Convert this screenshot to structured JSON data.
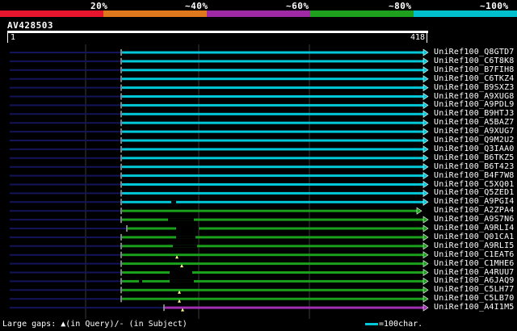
{
  "legend": {
    "labels": [
      "20%",
      "~40%",
      "~60%",
      "~80%",
      "~100%"
    ],
    "colors": [
      "#e8162c",
      "#e0781e",
      "#a02aa4",
      "#1ea01e",
      "#00c0d0"
    ]
  },
  "query": {
    "id": "AV428503",
    "start_label": "1",
    "end_label": "418"
  },
  "colors": {
    "cyan": "#00c8d8",
    "green": "#1aa01a",
    "purple": "#a030b0",
    "navy": "#14145a",
    "grid": "#3a3a3a",
    "gap_marker": "#ffff90"
  },
  "hits": [
    {
      "name": "UniRef100_Q8GTD7",
      "identity": "cyan"
    },
    {
      "name": "UniRef100_C6T8K8",
      "identity": "cyan"
    },
    {
      "name": "UniRef100_B7FIH8",
      "identity": "cyan"
    },
    {
      "name": "UniRef100_C6TKZ4",
      "identity": "cyan"
    },
    {
      "name": "UniRef100_B9SXZ3",
      "identity": "cyan"
    },
    {
      "name": "UniRef100_A9XUG8",
      "identity": "cyan"
    },
    {
      "name": "UniRef100_A9PDL9",
      "identity": "cyan"
    },
    {
      "name": "UniRef100_B9HTJ3",
      "identity": "cyan"
    },
    {
      "name": "UniRef100_A5BAZ7",
      "identity": "cyan"
    },
    {
      "name": "UniRef100_A9XUG7",
      "identity": "cyan"
    },
    {
      "name": "UniRef100_Q9M2U2",
      "identity": "cyan"
    },
    {
      "name": "UniRef100_Q3IAA0",
      "identity": "cyan"
    },
    {
      "name": "UniRef100_B6TKZ5",
      "identity": "cyan"
    },
    {
      "name": "UniRef100_B6T423",
      "identity": "cyan"
    },
    {
      "name": "UniRef100_B4F7W8",
      "identity": "cyan"
    },
    {
      "name": "UniRef100_C5XQ01",
      "identity": "cyan"
    },
    {
      "name": "UniRef100_Q5ZED1",
      "identity": "cyan"
    },
    {
      "name": "UniRef100_A9PGI4",
      "identity": "cyan"
    },
    {
      "name": "UniRef100_A2ZPA4",
      "identity": "green"
    },
    {
      "name": "UniRef100_A9S7N6",
      "identity": "green"
    },
    {
      "name": "UniRef100_A9RLI4",
      "identity": "green"
    },
    {
      "name": "UniRef100_Q01CA1",
      "identity": "green"
    },
    {
      "name": "UniRef100_A9RLI5",
      "identity": "green"
    },
    {
      "name": "UniRef100_C1EAT6",
      "identity": "green"
    },
    {
      "name": "UniRef100_C1MHE6",
      "identity": "green"
    },
    {
      "name": "UniRef100_A4RUU7",
      "identity": "green"
    },
    {
      "name": "UniRef100_A6JAQ9",
      "identity": "green"
    },
    {
      "name": "UniRef100_C5LH77",
      "identity": "green"
    },
    {
      "name": "UniRef100_C5LB70",
      "identity": "green"
    },
    {
      "name": "UniRef100_A4I1M5",
      "identity": "purple"
    }
  ],
  "footer": {
    "large_gaps_text": "Large gaps: ▲(in Query)/- (in Subject)",
    "scale_text": "=100char."
  }
}
